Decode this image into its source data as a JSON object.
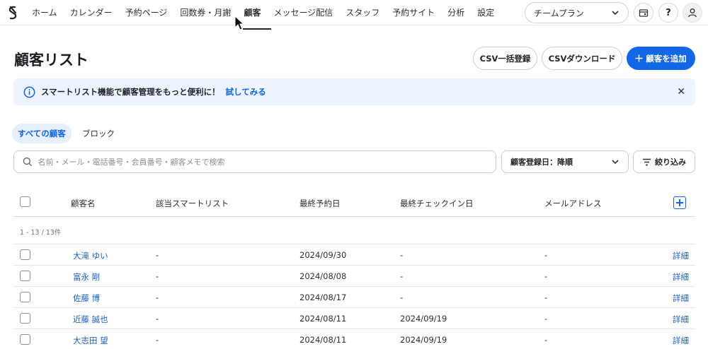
{
  "nav": {
    "items": [
      {
        "label": "ホーム",
        "active": false
      },
      {
        "label": "カレンダー",
        "active": false
      },
      {
        "label": "予約ページ",
        "active": false
      },
      {
        "label": "回数券・月謝",
        "active": false
      },
      {
        "label": "顧客",
        "active": true
      },
      {
        "label": "メッセージ配信",
        "active": false
      },
      {
        "label": "スタッフ",
        "active": false
      },
      {
        "label": "予約サイト",
        "active": false
      },
      {
        "label": "分析",
        "active": false
      },
      {
        "label": "設定",
        "active": false
      }
    ],
    "plan_select": "チームプラン",
    "help_label": "?"
  },
  "page": {
    "title": "顧客リスト",
    "csv_import_label": "CSV一括登録",
    "csv_download_label": "CSVダウンロード",
    "add_customer_label": "顧客を追加"
  },
  "banner": {
    "text": "スマートリスト機能で顧客管理をもっと便利に！",
    "link": "試してみる",
    "close": "✕"
  },
  "tabs": {
    "all": "すべての顧客",
    "blocked": "ブロック"
  },
  "search": {
    "placeholder": "名前・メール・電話番号・会員番号・顧客メモで検索"
  },
  "sort": {
    "selected": "顧客登録日：降順"
  },
  "filter": {
    "label": "絞り込み"
  },
  "table": {
    "headers": {
      "name": "顧客名",
      "smartlist": "該当スマートリスト",
      "last_booking": "最終予約日",
      "last_checkin": "最終チェックイン日",
      "email": "メールアドレス"
    },
    "count_text": "1 - 13 / 13件",
    "rows": [
      {
        "name": "大滝 ゆい",
        "smartlist": "-",
        "last_booking": "2024/09/30",
        "last_checkin": "-",
        "email": "-",
        "detail": "詳細"
      },
      {
        "name": "富永 剛",
        "smartlist": "-",
        "last_booking": "2024/08/08",
        "last_checkin": "-",
        "email": "-",
        "detail": "詳細"
      },
      {
        "name": "佐藤 博",
        "smartlist": "-",
        "last_booking": "2024/08/17",
        "last_checkin": "-",
        "email": "-",
        "detail": "詳細"
      },
      {
        "name": "近藤 誠也",
        "smartlist": "-",
        "last_booking": "2024/08/11",
        "last_checkin": "2024/09/19",
        "email": "-",
        "detail": "詳細"
      },
      {
        "name": "大志田 望",
        "smartlist": "-",
        "last_booking": "2024/08/11",
        "last_checkin": "2024/09/19",
        "email": "-",
        "detail": "詳細"
      }
    ]
  },
  "colors": {
    "accent": "#1366e6",
    "link": "#1d5fc2",
    "banner_bg": "#eef4fd"
  }
}
